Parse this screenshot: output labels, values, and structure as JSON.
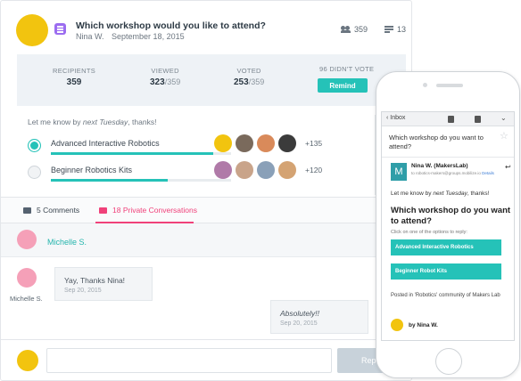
{
  "post": {
    "question": "Which workshop would you like to attend?",
    "author": "Nina W.",
    "date": "September 18, 2015",
    "recipients_count_top": "359",
    "comments_count_top": "13"
  },
  "stats": {
    "recipients_label": "RECIPIENTS",
    "recipients_value": "359",
    "viewed_label": "VIEWED",
    "viewed_value": "323",
    "viewed_total": "/359",
    "voted_label": "VOTED",
    "voted_value": "253",
    "voted_total": "/359",
    "didnt_vote_label": "96 DIDN'T VOTE",
    "remind_label": "Remind"
  },
  "poll": {
    "prompt_prefix": "Let me know by ",
    "prompt_deadline": "next Tuesday",
    "prompt_suffix": ", thanks!",
    "options": [
      {
        "label": "Advanced Interactive Robotics",
        "progress": 0.9,
        "selected": true,
        "more_voters": "+135"
      },
      {
        "label": "Beginner Robotics Kits",
        "progress": 0.65,
        "selected": false,
        "more_voters": "+120"
      }
    ]
  },
  "tabs": {
    "comments": "5 Comments",
    "private": "18 Private Conversations"
  },
  "conversation": {
    "with_name": "Michelle S.",
    "messages": [
      {
        "author": "Michelle S.",
        "text": "Yay, Thanks Nina!",
        "date": "Sep 20, 2015"
      },
      {
        "author": "",
        "text": "Absolutely!!",
        "date": "Sep 20, 2015"
      }
    ]
  },
  "composer": {
    "reply_label": "Reply"
  },
  "phone": {
    "back_label": "Inbox",
    "subject": "Which workshop do you want to attend?",
    "sender_initial": "M",
    "from": "Nina W. (MakersLab)",
    "to": "to robotics-makers@groups.mobilize.io",
    "details_label": "Details",
    "letme_prefix": "Let me know by ",
    "letme_deadline": "next Tuesday",
    "letme_suffix": ", thanks!",
    "question": "Which workshop do you want to attend?",
    "click_hint": "Click on one of the options to reply:",
    "option1": "Advanced Interactive Robotics",
    "option2": "Beginner Robot Kits",
    "posted_in": "Posted in 'Robotics' community of Makers Lab",
    "by_line": "by Nina W."
  },
  "colors": {
    "accent": "#25c2b8",
    "pink": "#f0417a",
    "badge": "#9b6cf0"
  }
}
